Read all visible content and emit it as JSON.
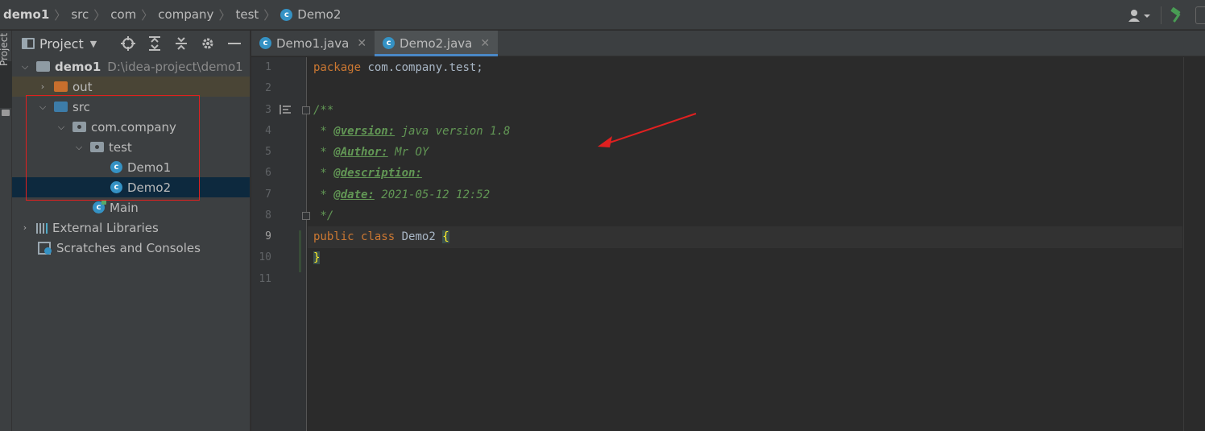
{
  "breadcrumb": {
    "items": [
      "demo1",
      "src",
      "com",
      "company",
      "test",
      "Demo2"
    ]
  },
  "left_strip": {
    "label": "Project"
  },
  "project_panel": {
    "title": "Project",
    "tree": [
      {
        "label": "demo1",
        "path": "D:\\idea-project\\demo1"
      },
      {
        "label": "out"
      },
      {
        "label": "src"
      },
      {
        "label": "com.company"
      },
      {
        "label": "test"
      },
      {
        "label": "Demo1"
      },
      {
        "label": "Demo2"
      },
      {
        "label": "Main"
      },
      {
        "label": "External Libraries"
      },
      {
        "label": "Scratches and Consoles"
      }
    ]
  },
  "tabs": [
    {
      "label": "Demo1.java",
      "active": false
    },
    {
      "label": "Demo2.java",
      "active": true
    }
  ],
  "editor": {
    "line_numbers": [
      "1",
      "2",
      "3",
      "4",
      "5",
      "6",
      "7",
      "8",
      "9",
      "10",
      "11"
    ],
    "current_line": "9",
    "code": {
      "l1_kw": "package",
      "l1_rest": " com.company.test;",
      "l3": "/**",
      "l4_prefix": " * ",
      "l4_tag": "@version:",
      "l4_text": " java version 1.8",
      "l5_prefix": " * ",
      "l5_tag": "@Author:",
      "l5_text": " Mr OY",
      "l6_prefix": " * ",
      "l6_tag": "@description:",
      "l7_prefix": " * ",
      "l7_tag": "@date:",
      "l7_text": " 2021-05-12 12:52",
      "l8": " */",
      "l9_kw1": "public",
      "l9_kw2": "class",
      "l9_name": "Demo2",
      "l9_brace": "{",
      "l10_brace": "}"
    }
  },
  "colors": {
    "accent": "#4a88c7",
    "keyword": "#cc7832",
    "doc_comment": "#629755",
    "annotation_red": "#e02020"
  }
}
